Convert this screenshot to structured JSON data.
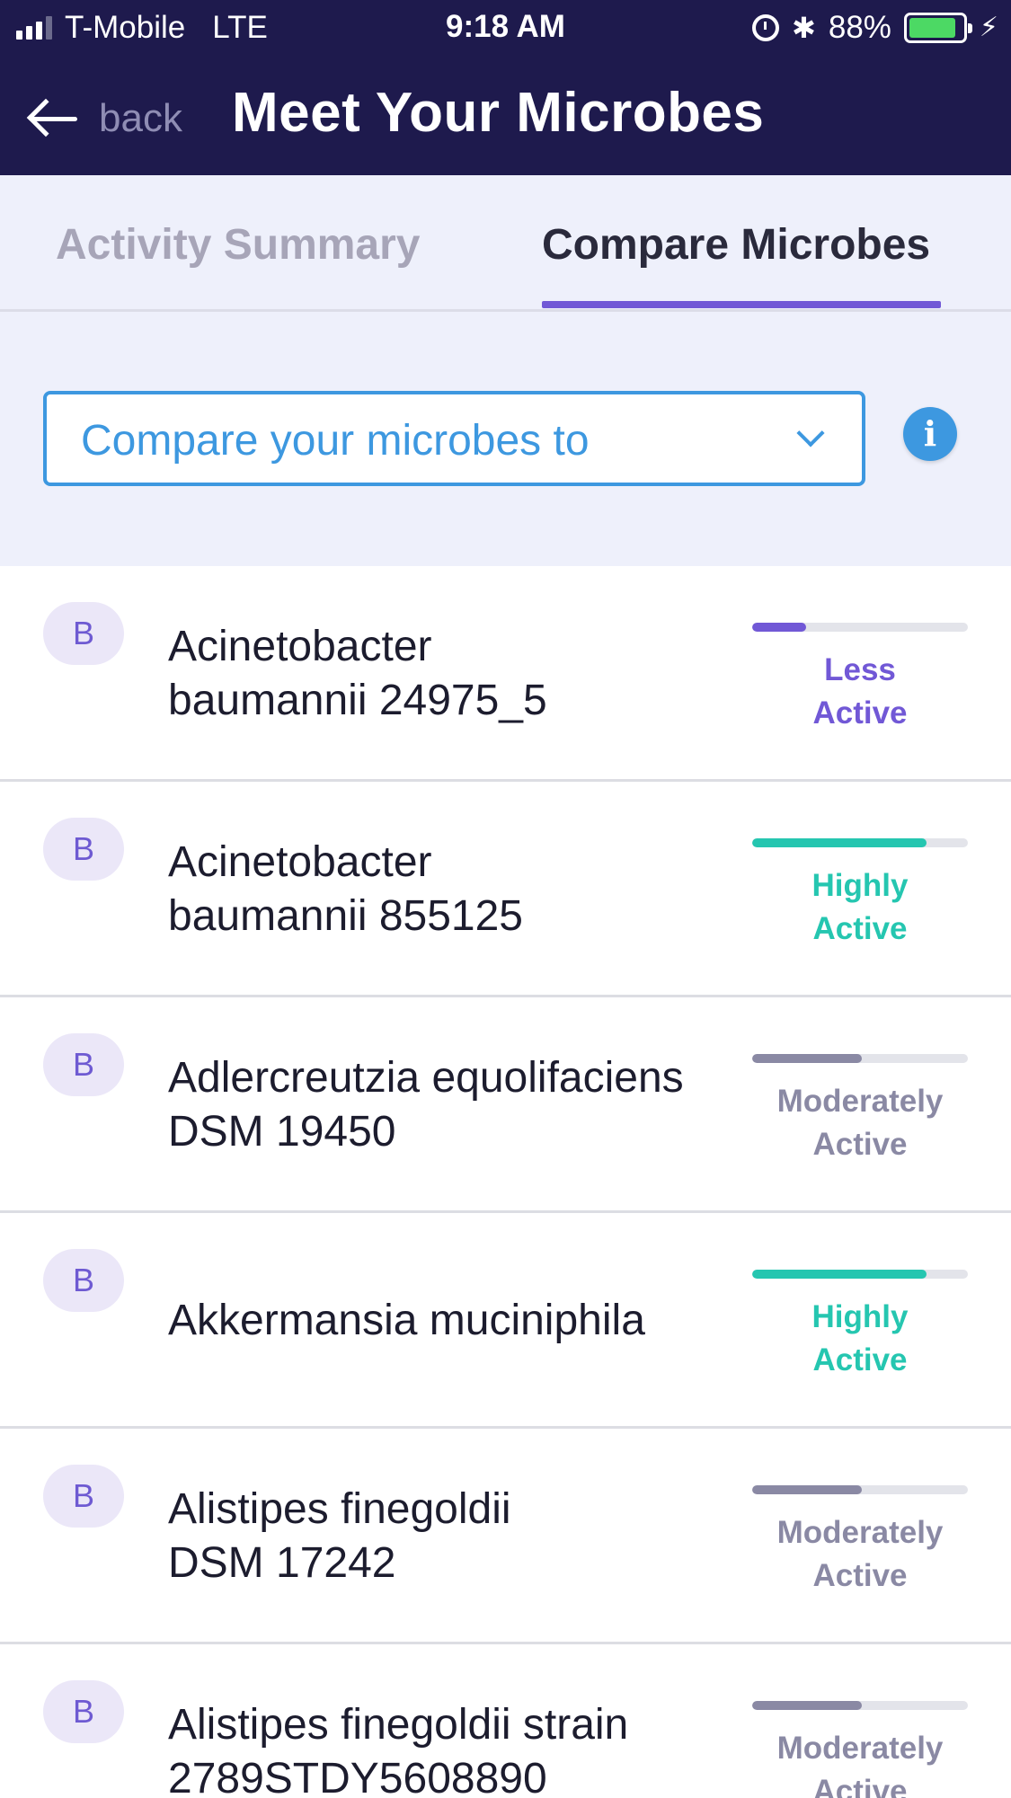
{
  "status_bar": {
    "carrier": "T-Mobile",
    "network": "LTE",
    "time": "9:18 AM",
    "battery": "88%",
    "battery_level": 0.88
  },
  "nav": {
    "back_label": "back",
    "title": "Meet Your Microbes"
  },
  "tabs": [
    {
      "label": "Activity Summary",
      "active": false
    },
    {
      "label": "Compare Microbes",
      "active": true
    }
  ],
  "compare": {
    "placeholder": "Compare your microbes to",
    "info_label": "i"
  },
  "colors": {
    "header_bg": "#1e1a4d",
    "accent_purple": "#7158d6",
    "select_blue": "#3d98e0",
    "less_active": "#7158d6",
    "highly_active": "#25c6b0",
    "moderately_active": "#8a89a4"
  },
  "microbes": [
    {
      "badge": "B",
      "name_line1": "Acinetobacter",
      "name_line2": "baumannii 24975_5",
      "status_line1": "Less",
      "status_line2": "Active",
      "level": 0.25,
      "color": "#7158d6"
    },
    {
      "badge": "B",
      "name_line1": "Acinetobacter",
      "name_line2": "baumannii 855125",
      "status_line1": "Highly",
      "status_line2": "Active",
      "level": 0.81,
      "color": "#25c6b0"
    },
    {
      "badge": "B",
      "name_line1": "Adlercreutzia equolifaciens",
      "name_line2": "DSM 19450",
      "status_line1": "Moderately",
      "status_line2": "Active",
      "level": 0.51,
      "color": "#8a89a4"
    },
    {
      "badge": "B",
      "name_line1": "Akkermansia muciniphila",
      "name_line2": "",
      "status_line1": "Highly",
      "status_line2": "Active",
      "level": 0.81,
      "color": "#25c6b0"
    },
    {
      "badge": "B",
      "name_line1": "Alistipes finegoldii",
      "name_line2": "DSM 17242",
      "status_line1": "Moderately",
      "status_line2": "Active",
      "level": 0.51,
      "color": "#8a89a4"
    },
    {
      "badge": "B",
      "name_line1": "Alistipes finegoldii strain",
      "name_line2": "2789STDY5608890",
      "status_line1": "Moderately",
      "status_line2": "Active",
      "level": 0.51,
      "color": "#8a89a4"
    }
  ]
}
